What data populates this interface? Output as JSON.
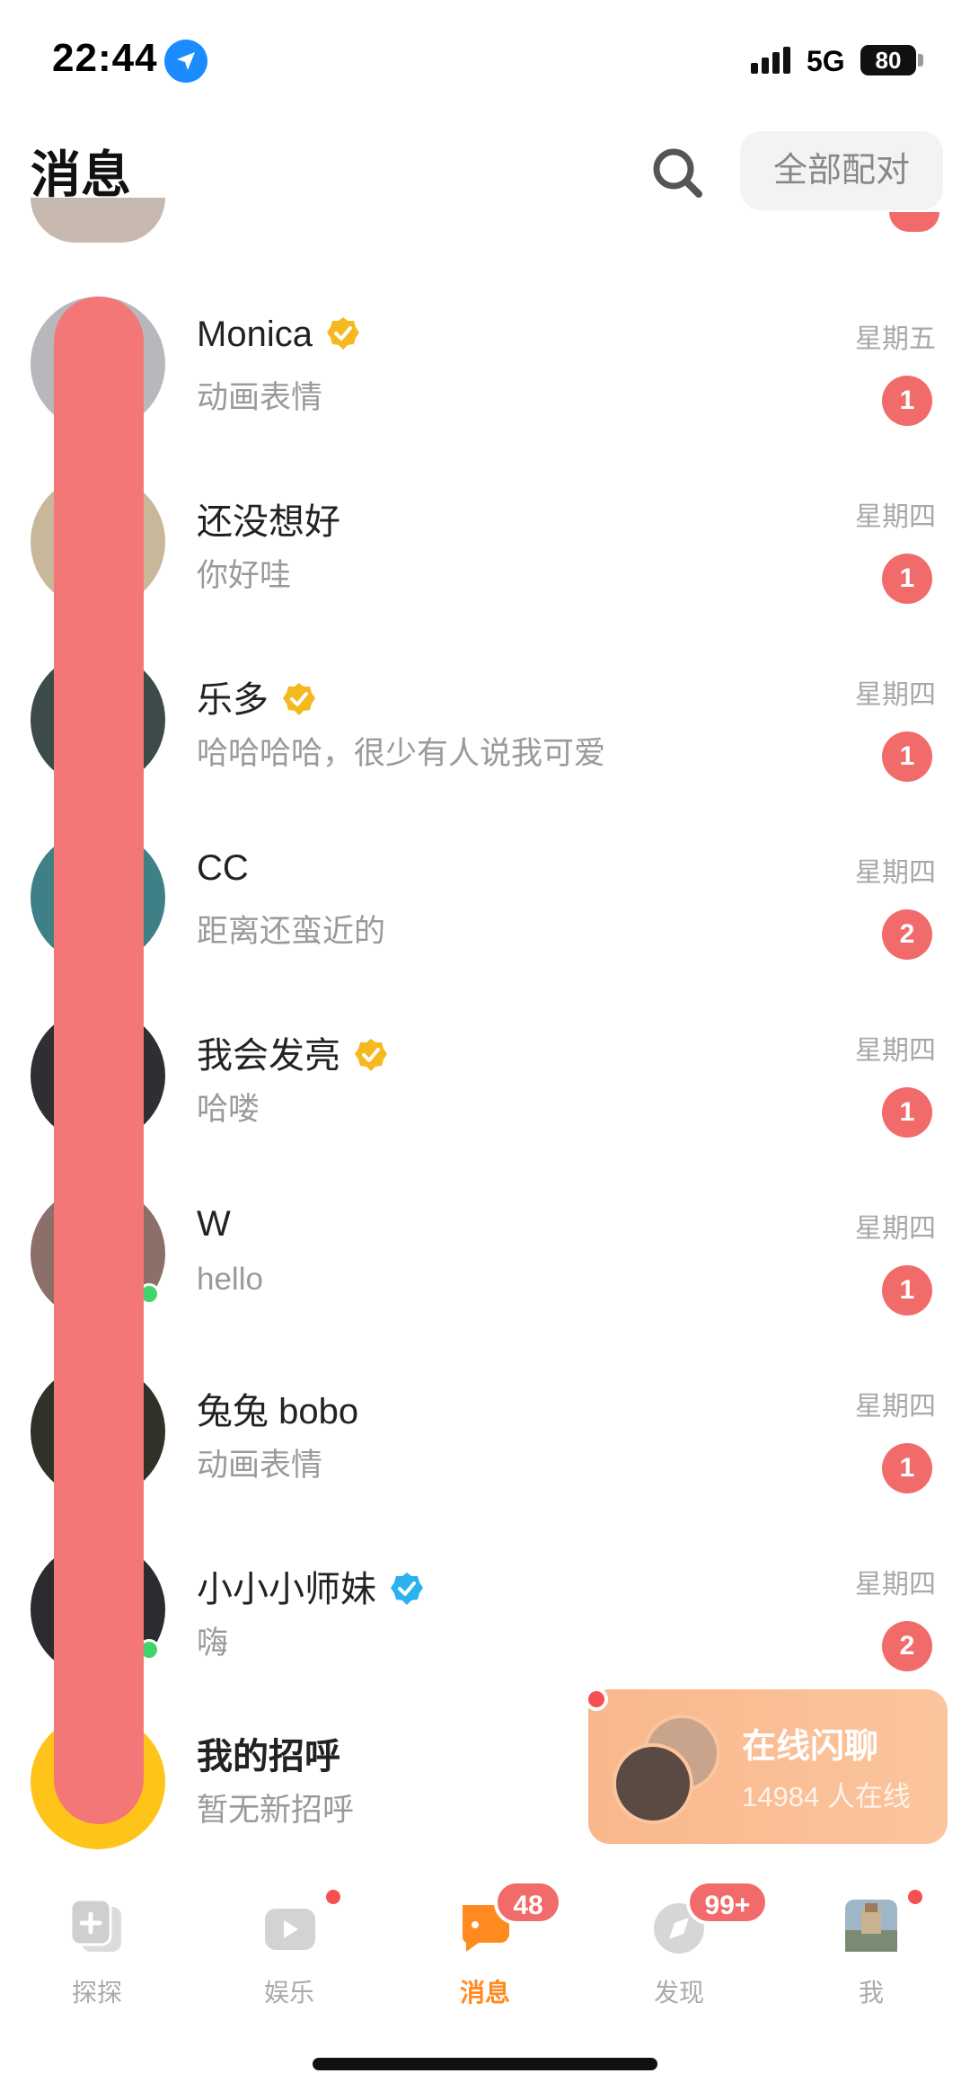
{
  "status_bar": {
    "time": "22:44",
    "network": "5G",
    "battery": "80"
  },
  "header": {
    "title": "消息",
    "pair_button": "全部配对",
    "search_icon": "search-icon"
  },
  "messages": [
    {
      "name": "Monica",
      "verified": "gold",
      "preview": "动画表情",
      "day": "星期五",
      "unread": "1",
      "avatar_color": "#b8b8bc"
    },
    {
      "name": "还没想好",
      "verified": "",
      "preview": "你好哇",
      "day": "星期四",
      "unread": "1",
      "avatar_color": "#c9b79a"
    },
    {
      "name": "乐多",
      "verified": "gold",
      "preview": "哈哈哈哈，很少有人说我可爱",
      "day": "星期四",
      "unread": "1",
      "avatar_color": "#3c4a4a"
    },
    {
      "name": "CC",
      "verified": "",
      "preview": "距离还蛮近的",
      "day": "星期四",
      "unread": "2",
      "avatar_color": "#3f7f86"
    },
    {
      "name": "我会发亮",
      "verified": "gold",
      "preview": "哈喽",
      "day": "星期四",
      "unread": "1",
      "avatar_color": "#2e2e33"
    },
    {
      "name": "W",
      "verified": "",
      "preview": "hello",
      "day": "星期四",
      "unread": "1",
      "avatar_color": "#8c6f68",
      "online": true
    },
    {
      "name": "兔兔 bobo",
      "verified": "",
      "preview": "动画表情",
      "day": "星期四",
      "unread": "1",
      "avatar_color": "#2f3327"
    },
    {
      "name": "小小小师妹",
      "verified": "blue",
      "preview": "嗨",
      "day": "星期四",
      "unread": "2",
      "avatar_color": "#2c2c30",
      "online": true
    }
  ],
  "greetings": {
    "title": "我的招呼",
    "subtitle": "暂无新招呼"
  },
  "online_chat": {
    "title": "在线闪聊",
    "subtitle": "14984 人在线"
  },
  "tabs": [
    {
      "label": "探探",
      "icon": "tantan-icon"
    },
    {
      "label": "娱乐",
      "icon": "play-icon"
    },
    {
      "label": "消息",
      "icon": "message-icon",
      "count": "48"
    },
    {
      "label": "发现",
      "icon": "discover-icon",
      "count": "99+"
    },
    {
      "label": "我",
      "icon": "profile-avatar-icon"
    }
  ],
  "colors": {
    "accent": "#ff8a1f",
    "badge": "#f26b6b",
    "verify_gold": "#f5b81f",
    "verify_blue": "#2ab1f0",
    "online": "#44d36a"
  }
}
